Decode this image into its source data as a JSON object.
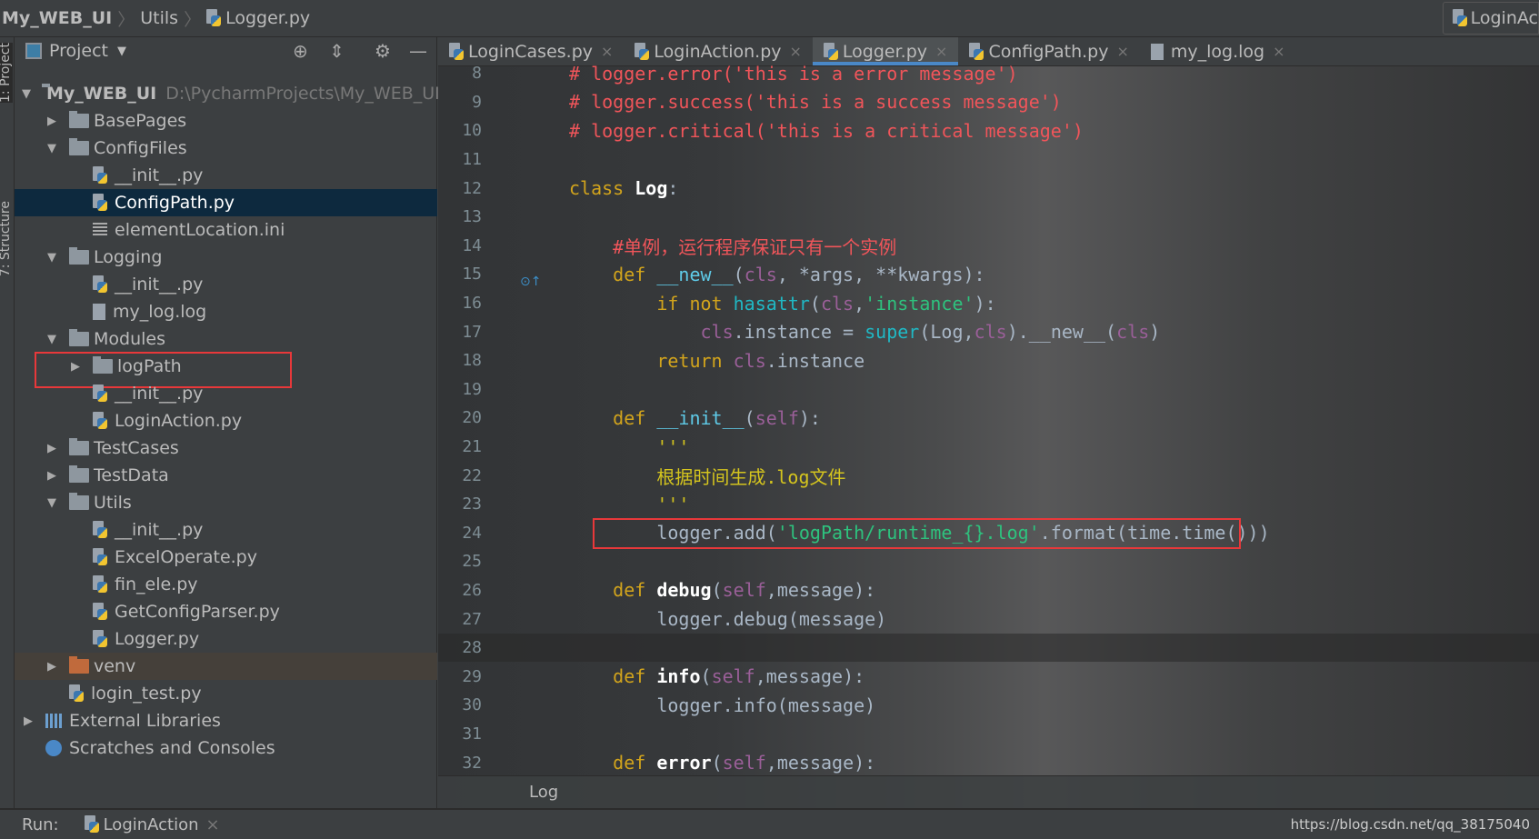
{
  "breadcrumb": [
    "My_WEB_UI",
    "Utils",
    "Logger.py"
  ],
  "run_config": "LoginAc",
  "project_panel": {
    "title": "Project",
    "tools": [
      "⊕",
      "⇕",
      "⚙",
      "—"
    ]
  },
  "side_stripe": [
    "1: Project",
    "7: Structure"
  ],
  "tree": [
    {
      "level": 0,
      "arrow": "▼",
      "icon": "folder",
      "label": "My_WEB_UI",
      "hint": "D:\\PycharmProjects\\My_WEB_UI",
      "bold": true
    },
    {
      "level": 1,
      "arrow": "▶",
      "icon": "folder",
      "label": "BasePages"
    },
    {
      "level": 1,
      "arrow": "▼",
      "icon": "folder",
      "label": "ConfigFiles"
    },
    {
      "level": 2,
      "arrow": "",
      "icon": "py",
      "label": "__init__.py"
    },
    {
      "level": 2,
      "arrow": "",
      "icon": "py",
      "label": "ConfigPath.py",
      "selected": true
    },
    {
      "level": 2,
      "arrow": "",
      "icon": "ini",
      "label": "elementLocation.ini"
    },
    {
      "level": 1,
      "arrow": "▼",
      "icon": "folder",
      "label": "Logging"
    },
    {
      "level": 2,
      "arrow": "",
      "icon": "log",
      "label": "__init__.py",
      "iconpy": true
    },
    {
      "level": 2,
      "arrow": "",
      "icon": "log",
      "label": "my_log.log"
    },
    {
      "level": 1,
      "arrow": "▼",
      "icon": "folder",
      "label": "Modules"
    },
    {
      "level": 2,
      "arrow": "▶",
      "icon": "folder",
      "label": "logPath",
      "highlighted": true
    },
    {
      "level": 2,
      "arrow": "",
      "icon": "py",
      "label": "__init__.py"
    },
    {
      "level": 2,
      "arrow": "",
      "icon": "py",
      "label": "LoginAction.py"
    },
    {
      "level": 1,
      "arrow": "▶",
      "icon": "folder",
      "label": "TestCases"
    },
    {
      "level": 1,
      "arrow": "▶",
      "icon": "folder",
      "label": "TestData"
    },
    {
      "level": 1,
      "arrow": "▼",
      "icon": "folder",
      "label": "Utils"
    },
    {
      "level": 2,
      "arrow": "",
      "icon": "py",
      "label": "__init__.py"
    },
    {
      "level": 2,
      "arrow": "",
      "icon": "py",
      "label": "ExcelOperate.py"
    },
    {
      "level": 2,
      "arrow": "",
      "icon": "py",
      "label": "fin_ele.py"
    },
    {
      "level": 2,
      "arrow": "",
      "icon": "py",
      "label": "GetConfigParser.py"
    },
    {
      "level": 2,
      "arrow": "",
      "icon": "py",
      "label": "Logger.py"
    },
    {
      "level": 1,
      "arrow": "▶",
      "icon": "folder-orange",
      "label": "venv",
      "venv": true
    },
    {
      "level": 1,
      "arrow": "",
      "icon": "py",
      "label": "login_test.py"
    },
    {
      "level": 0,
      "arrow": "▶",
      "icon": "lib",
      "label": "External Libraries"
    },
    {
      "level": 0,
      "arrow": "",
      "icon": "scratch",
      "label": "Scratches and Consoles"
    }
  ],
  "tabs": [
    {
      "label": "LoginCases.py",
      "icon": "py"
    },
    {
      "label": "LoginAction.py",
      "icon": "py"
    },
    {
      "label": "Logger.py",
      "icon": "py",
      "active": true
    },
    {
      "label": "ConfigPath.py",
      "icon": "py"
    },
    {
      "label": "my_log.log",
      "icon": "log"
    }
  ],
  "code": [
    {
      "n": 8,
      "t": [
        [
          "c",
          "# logger.error('this is a error message')"
        ]
      ]
    },
    {
      "n": 9,
      "t": [
        [
          "c",
          "# logger.success('this is a success message')"
        ]
      ]
    },
    {
      "n": 10,
      "t": [
        [
          "c",
          "# logger.critical('this is a critical message')"
        ]
      ]
    },
    {
      "n": 11,
      "t": []
    },
    {
      "n": 12,
      "t": [
        [
          "k",
          "class"
        ],
        [
          "n",
          " "
        ],
        [
          "w",
          "Log"
        ],
        [
          "n",
          ":"
        ]
      ]
    },
    {
      "n": 13,
      "t": []
    },
    {
      "n": 14,
      "t": [
        [
          "n",
          "    "
        ],
        [
          "c",
          "#单例，运行程序保证只有一个实例"
        ]
      ]
    },
    {
      "n": 15,
      "override": true,
      "t": [
        [
          "n",
          "    "
        ],
        [
          "k",
          "def"
        ],
        [
          "n",
          " "
        ],
        [
          "d",
          "__new__"
        ],
        [
          "n",
          "("
        ],
        [
          "p",
          "cls"
        ],
        [
          "n",
          ", *args, **kwargs):"
        ]
      ]
    },
    {
      "n": 16,
      "t": [
        [
          "n",
          "        "
        ],
        [
          "k",
          "if not"
        ],
        [
          "n",
          " "
        ],
        [
          "f",
          "hasattr"
        ],
        [
          "n",
          "("
        ],
        [
          "p",
          "cls"
        ],
        [
          "n",
          ","
        ],
        [
          "s",
          "'instance'"
        ],
        [
          "n",
          "):"
        ]
      ]
    },
    {
      "n": 17,
      "t": [
        [
          "n",
          "            "
        ],
        [
          "p",
          "cls"
        ],
        [
          "n",
          ".instance = "
        ],
        [
          "f",
          "super"
        ],
        [
          "n",
          "(Log,"
        ],
        [
          "p",
          "cls"
        ],
        [
          "n",
          ").__new__("
        ],
        [
          "p",
          "cls"
        ],
        [
          "n",
          ")"
        ]
      ]
    },
    {
      "n": 18,
      "t": [
        [
          "n",
          "        "
        ],
        [
          "k",
          "return"
        ],
        [
          "n",
          " "
        ],
        [
          "p",
          "cls"
        ],
        [
          "n",
          ".instance"
        ]
      ]
    },
    {
      "n": 19,
      "t": []
    },
    {
      "n": 20,
      "t": [
        [
          "n",
          "    "
        ],
        [
          "k",
          "def"
        ],
        [
          "n",
          " "
        ],
        [
          "d",
          "__init__"
        ],
        [
          "n",
          "("
        ],
        [
          "p",
          "self"
        ],
        [
          "n",
          "):"
        ]
      ]
    },
    {
      "n": 21,
      "t": [
        [
          "n",
          "        "
        ],
        [
          "y",
          "'''"
        ]
      ]
    },
    {
      "n": 22,
      "t": [
        [
          "n",
          "        "
        ],
        [
          "y",
          "根据时间生成.log文件"
        ]
      ]
    },
    {
      "n": 23,
      "t": [
        [
          "n",
          "        "
        ],
        [
          "y",
          "'''"
        ]
      ]
    },
    {
      "n": 24,
      "boxed": true,
      "t": [
        [
          "n",
          "        logger.add("
        ],
        [
          "s",
          "'logPath/runtime_{}.log'"
        ],
        [
          "n",
          ".format(time.time()))"
        ]
      ]
    },
    {
      "n": 25,
      "t": []
    },
    {
      "n": 26,
      "t": [
        [
          "n",
          "    "
        ],
        [
          "k",
          "def"
        ],
        [
          "n",
          " "
        ],
        [
          "w",
          "debug"
        ],
        [
          "n",
          "("
        ],
        [
          "p",
          "self"
        ],
        [
          "n",
          ",message):"
        ]
      ]
    },
    {
      "n": 27,
      "t": [
        [
          "n",
          "        logger.debug(message)"
        ]
      ]
    },
    {
      "n": 28,
      "current": true,
      "t": []
    },
    {
      "n": 29,
      "t": [
        [
          "n",
          "    "
        ],
        [
          "k",
          "def"
        ],
        [
          "n",
          " "
        ],
        [
          "w",
          "info"
        ],
        [
          "n",
          "("
        ],
        [
          "p",
          "self"
        ],
        [
          "n",
          ",message):"
        ]
      ]
    },
    {
      "n": 30,
      "t": [
        [
          "n",
          "        logger.info(message)"
        ]
      ]
    },
    {
      "n": 31,
      "t": []
    },
    {
      "n": 32,
      "t": [
        [
          "n",
          "    "
        ],
        [
          "k",
          "def"
        ],
        [
          "n",
          " "
        ],
        [
          "w",
          "error"
        ],
        [
          "n",
          "("
        ],
        [
          "p",
          "self"
        ],
        [
          "n",
          ",message):"
        ]
      ]
    }
  ],
  "editor_breadcrumb": "Log",
  "run": {
    "label": "Run:",
    "config": "LoginAction",
    "close": "×"
  },
  "watermark": "https://blog.csdn.net/qq_38175040",
  "colors": {
    "highlight_box": "#e8383a",
    "active_tab": "#4a88c7",
    "selection": "#0d293e"
  }
}
